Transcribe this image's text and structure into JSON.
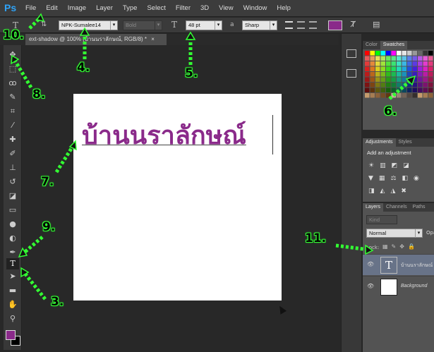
{
  "app": {
    "logo": "Ps"
  },
  "menu": [
    "File",
    "Edit",
    "Image",
    "Layer",
    "Type",
    "Select",
    "Filter",
    "3D",
    "View",
    "Window",
    "Help"
  ],
  "options": {
    "tool_glyph": "T",
    "font_family": "NPK-Sumalee14",
    "font_style": "Bold",
    "size_glyph": "T",
    "font_size": "48 pt",
    "aa_label": "a",
    "antialias": "Sharp",
    "text_color": "#8a2a8a"
  },
  "document": {
    "tab_title": "ext-shadow @ 100% (บ้านนราลักษณ์, RGB/8) *",
    "tab_close": "×"
  },
  "canvas": {
    "text": "บ้านนราลักษณ์"
  },
  "swatches_panel": {
    "tabs": [
      "Color",
      "Swatches"
    ]
  },
  "adjustments_panel": {
    "tabs": [
      "Adjustments",
      "Styles"
    ],
    "heading": "Add an adjustment"
  },
  "layers_panel": {
    "tabs": [
      "Layers",
      "Channels",
      "Paths"
    ],
    "kind_label": "Kind",
    "blend_mode": "Normal",
    "opacity_label": "Opa",
    "lock_label": "Lock:",
    "layers": [
      {
        "thumb": "T",
        "name": "บ้านนราลักษณ์"
      },
      {
        "thumb": "",
        "name": "Background"
      }
    ]
  },
  "annotations": [
    "10.",
    "4.",
    "5.",
    "8.",
    "6.",
    "7.",
    "9.",
    "3.",
    "11."
  ],
  "colors": {
    "accent_text": "#8a2a8a",
    "annotation_green": "#33ff33"
  }
}
